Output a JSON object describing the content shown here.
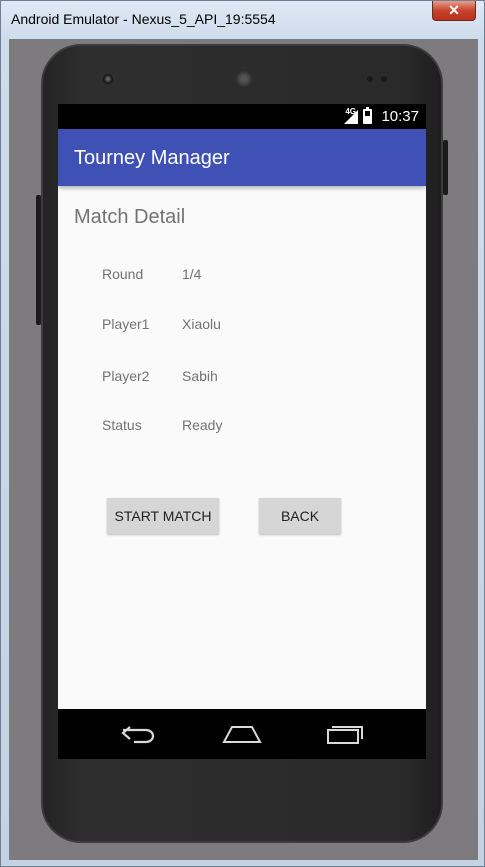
{
  "window": {
    "title": "Android Emulator - Nexus_5_API_19:5554",
    "close_glyph": "✕"
  },
  "status_bar": {
    "network": "4G",
    "time": "10:37"
  },
  "app_bar": {
    "title": "Tourney Manager"
  },
  "page": {
    "heading": "Match Detail",
    "details": [
      {
        "label": "Round",
        "value": "1/4"
      },
      {
        "label": "Player1",
        "value": "Xiaolu"
      },
      {
        "label": "Player2",
        "value": "Sabih"
      },
      {
        "label": "Status",
        "value": "Ready"
      }
    ],
    "buttons": {
      "start": "START MATCH",
      "back": "BACK"
    }
  },
  "nav_bar": {
    "icons": [
      "back-icon",
      "home-icon",
      "recent-apps-icon"
    ]
  },
  "colors": {
    "app_bar": "#3f51b5",
    "screen_bg": "#fafafa",
    "text_secondary": "#737373",
    "button_bg": "#d6d6d6"
  }
}
